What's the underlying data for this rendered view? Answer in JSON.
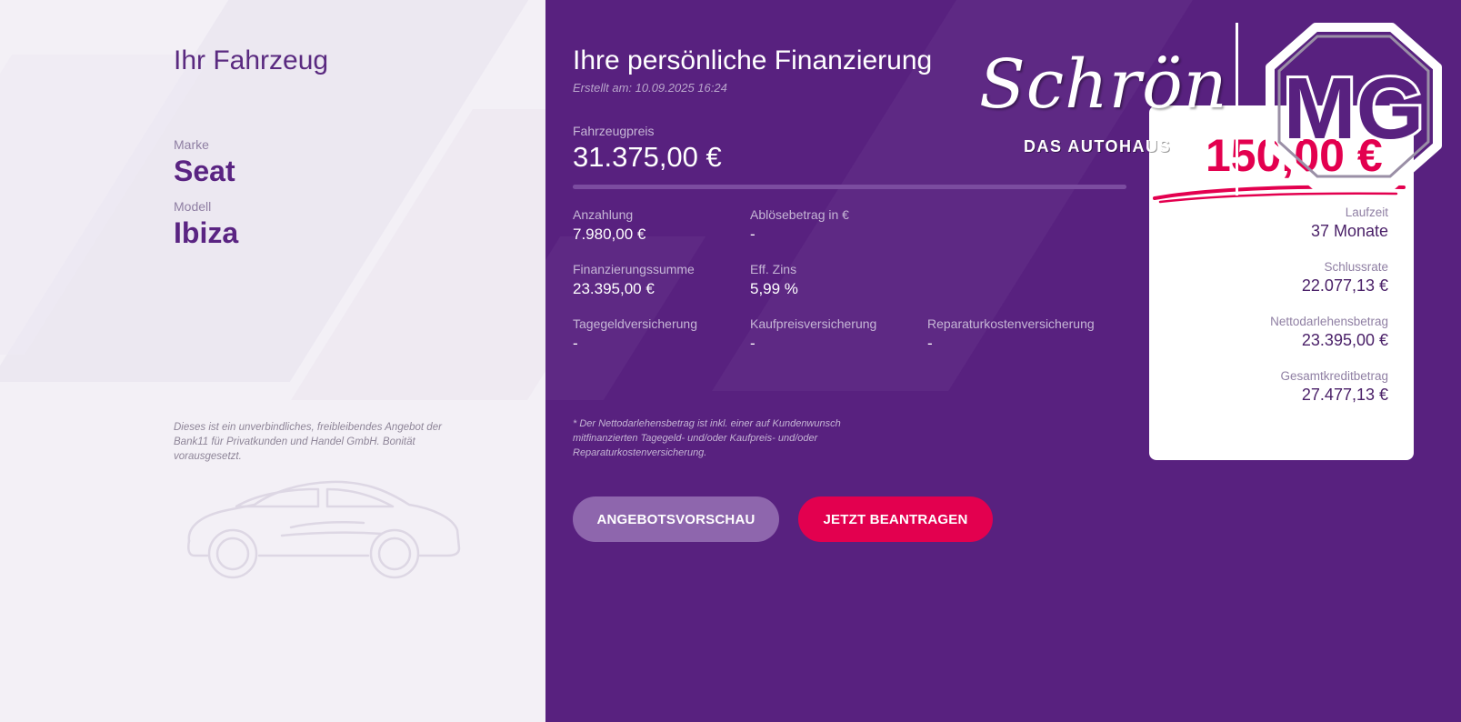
{
  "vehicle": {
    "title": "Ihr Fahrzeug",
    "make_label": "Marke",
    "make_value": "Seat",
    "model_label": "Modell",
    "model_value": "Ibiza",
    "disclaimer": "Dieses ist ein unverbindliches, freibleibendes Angebot der Bank11 für Privatkunden und Handel GmbH. Bonität vorausgesetzt."
  },
  "financing": {
    "title": "Ihre persönliche Finanzierung",
    "created": "Erstellt am: 10.09.2025 16:24",
    "price_label": "Fahrzeugpreis",
    "price_value": "31.375,00 €",
    "progress_fraction": 1.0,
    "fields": {
      "down_payment": {
        "label": "Anzahlung",
        "value": "7.980,00 €"
      },
      "payoff": {
        "label": "Ablösebetrag in €",
        "value": "-"
      },
      "financing_sum": {
        "label": "Finanzierungssumme",
        "value": "23.395,00 €"
      },
      "interest": {
        "label": "Eff. Zins",
        "value": "5,99 %"
      },
      "daily_insurance": {
        "label": "Tagegeldversicherung",
        "value": "-"
      },
      "purchase_insurance": {
        "label": "Kaufpreisversicherung",
        "value": "-"
      },
      "repair_insurance": {
        "label": "Reparaturkostenversicherung",
        "value": "-"
      }
    },
    "note": "* Der Nettodarlehensbetrag ist inkl. einer auf Kundenwunsch mitfinanzierten Tagegeld- und/oder Kaufpreis- und/oder Reparaturkostenversicherung.",
    "buttons": {
      "preview": "ANGEBOTSVORSCHAU",
      "apply": "JETZT BEANTRAGEN"
    }
  },
  "summary": {
    "monthly_rate": "150,00 €",
    "term_label": "Laufzeit",
    "term_value": "37 Monate",
    "final_rate_label": "Schlussrate",
    "final_rate_value": "22.077,13 €",
    "net_loan_label": "Nettodarlehensbetrag",
    "net_loan_value": "23.395,00 €",
    "total_credit_label": "Gesamtkreditbetrag",
    "total_credit_value": "27.477,13 €"
  },
  "logo": {
    "script": "Schrön",
    "tagline": "DAS AUTOHAUS",
    "brand": "MG"
  },
  "colors": {
    "primary_purple": "#58217f",
    "accent_red": "#e3004f",
    "light_bg": "#f3f0f6"
  }
}
